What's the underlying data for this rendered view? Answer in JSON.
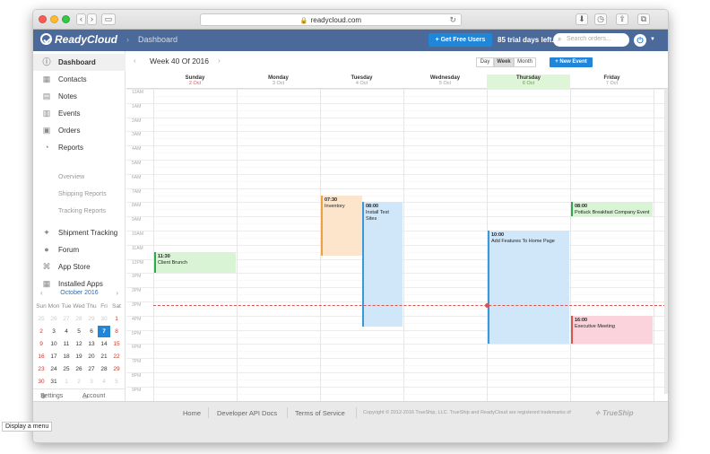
{
  "browser": {
    "url": "readycloud.com"
  },
  "app": {
    "brand": "ReadyCloud",
    "breadcrumb": "Dashboard",
    "free_users_label": "Get Free Users",
    "trial_text": "85 trial days left.",
    "search_placeholder": "Search orders...",
    "accent": "#1f86d9",
    "header_color": "#4b6a99"
  },
  "sidebar": {
    "items": [
      {
        "label": "Dashboard",
        "icon": "info-icon"
      },
      {
        "label": "Contacts",
        "icon": "contacts-icon"
      },
      {
        "label": "Notes",
        "icon": "notes-icon"
      },
      {
        "label": "Events",
        "icon": "events-icon"
      },
      {
        "label": "Orders",
        "icon": "orders-icon"
      },
      {
        "label": "Reports",
        "icon": "reports-icon"
      }
    ],
    "subitems": [
      "Overview",
      "Shipping Reports",
      "Tracking Reports"
    ],
    "items2": [
      {
        "label": "Shipment Tracking",
        "icon": "tracking-icon"
      },
      {
        "label": "Forum",
        "icon": "forum-icon"
      },
      {
        "label": "App Store",
        "icon": "app-store-icon"
      },
      {
        "label": "Installed Apps",
        "icon": "installed-apps-icon"
      }
    ],
    "settings_label": "Settings",
    "account_label": "Account"
  },
  "minical": {
    "month": "October 2016",
    "dow": [
      "Sun",
      "Mon",
      "Tue",
      "Wed",
      "Thu",
      "Fri",
      "Sat"
    ],
    "weeks": [
      [
        "25",
        "26",
        "27",
        "28",
        "29",
        "30",
        "1"
      ],
      [
        "2",
        "3",
        "4",
        "5",
        "6",
        "7",
        "8"
      ],
      [
        "9",
        "10",
        "11",
        "12",
        "13",
        "14",
        "15"
      ],
      [
        "16",
        "17",
        "18",
        "19",
        "20",
        "21",
        "22"
      ],
      [
        "23",
        "24",
        "25",
        "26",
        "27",
        "28",
        "29"
      ],
      [
        "30",
        "31",
        "1",
        "2",
        "3",
        "4",
        "5"
      ]
    ],
    "today": "7"
  },
  "calendar": {
    "week_title": "Week 40 Of 2016",
    "views": [
      "Day",
      "Week",
      "Month"
    ],
    "active_view": "Week",
    "new_event_label": "New Event",
    "days": [
      {
        "name": "Sunday",
        "date": "2 Oct"
      },
      {
        "name": "Monday",
        "date": "3 Oct"
      },
      {
        "name": "Tuesday",
        "date": "4 Oct"
      },
      {
        "name": "Wednesday",
        "date": "5 Oct"
      },
      {
        "name": "Thursday",
        "date": "6 Oct"
      },
      {
        "name": "Friday",
        "date": "7 Oct"
      }
    ],
    "hours": [
      "12AM",
      "1AM",
      "2AM",
      "3AM",
      "4AM",
      "5AM",
      "6AM",
      "7AM",
      "8AM",
      "9AM",
      "10AM",
      "11AM",
      "12PM",
      "1PM",
      "2PM",
      "3PM",
      "4PM",
      "5PM",
      "6PM",
      "7PM",
      "8PM",
      "9PM"
    ],
    "events": [
      {
        "day": 0,
        "time": "11:30",
        "title": "Client Brunch",
        "start": 11.5,
        "end": 13.0,
        "bg": "#d9f3d5",
        "border": "#2fa84f"
      },
      {
        "day": 2,
        "time": "07:30",
        "title": "Inventory",
        "start": 7.5,
        "end": 11.75,
        "bg": "#fde5cc",
        "border": "#f0a142",
        "half": "left"
      },
      {
        "day": 2,
        "time": "08:00",
        "title": "Install Test Sites",
        "start": 8.0,
        "end": 16.75,
        "bg": "#cfe7f8",
        "border": "#3a9ad9",
        "half": "right"
      },
      {
        "day": 4,
        "time": "10:00",
        "title": "Add Features To Home Page",
        "start": 10.0,
        "end": 18.0,
        "bg": "#cfe7f8",
        "border": "#3a9ad9"
      },
      {
        "day": 5,
        "time": "08:00",
        "title": "Potluck Breakfast Company Event",
        "start": 8.0,
        "end": 9.0,
        "bg": "#d9f3d5",
        "border": "#2fa84f"
      },
      {
        "day": 5,
        "time": "16:00",
        "title": "Executive Meeting",
        "start": 16.0,
        "end": 18.0,
        "bg": "#fbd3dc",
        "border": "#d9534f"
      }
    ],
    "now_hour": 15.25
  },
  "footer": {
    "links": [
      "Home",
      "Developer API Docs",
      "Terms of Service"
    ],
    "copyright": "Copyright © 2012-2016 TrueShip, LLC. TrueShip and ReadyCloud are registered trademarks of",
    "trueship": "TrueShip"
  },
  "tooltip": "Display a menu"
}
